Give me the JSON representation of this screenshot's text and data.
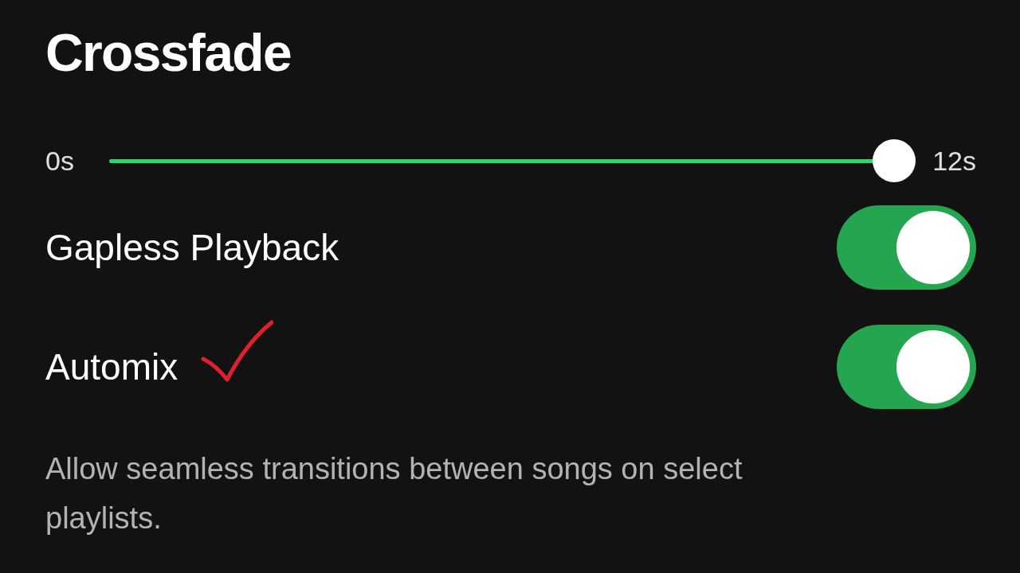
{
  "title": "Crossfade",
  "crossfade": {
    "min_label": "0s",
    "max_label": "12s",
    "level": 1
  },
  "settings": [
    {
      "label": "Gapless Playback",
      "on": true
    },
    {
      "label": "Automix",
      "on": true,
      "annotated": true
    }
  ],
  "description": "Allow seamless transitions between songs on select playlists."
}
